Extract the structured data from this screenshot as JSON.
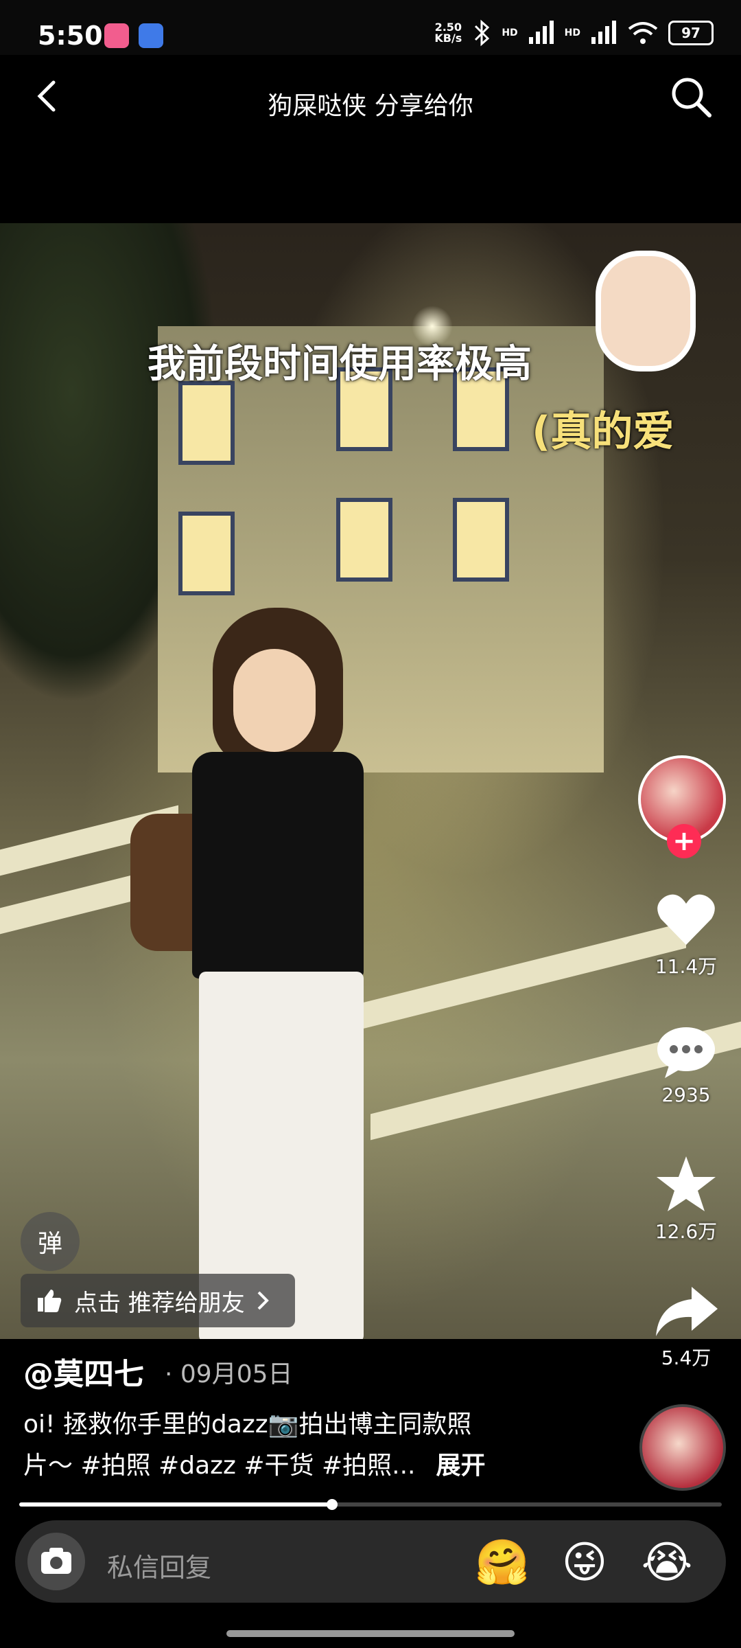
{
  "status_bar": {
    "time": "5:50",
    "net_speed_value": "2.50",
    "net_speed_unit": "KB/s",
    "hd1": "HD",
    "hd2": "HD",
    "battery": "97"
  },
  "nav": {
    "title": "狗屎哒侠 分享给你"
  },
  "video": {
    "caption_main": "我前段时间使用率极高",
    "caption_sub": "(真的爱",
    "danmu_label": "弹",
    "recommend_label": "点击 推荐给朋友"
  },
  "actions": {
    "likes": "11.4万",
    "comments": "2935",
    "favorites": "12.6万",
    "shares": "5.4万"
  },
  "post": {
    "author": "@莫四七",
    "date": "· 09月05日",
    "desc_line1": "oi! 拯救你手里的dazz📷拍出博主同款照",
    "desc_line2": "片～ #拍照 #dazz #干货 #拍照...",
    "expand": "展开"
  },
  "playback": {
    "progress": 0.445
  },
  "reply": {
    "placeholder": "私信回复",
    "emoji1": "🤗",
    "emoji2": "😜",
    "emoji3": "😭"
  },
  "colors": {
    "accent": "#fe2c55",
    "caption_sub": "#f7e07a"
  }
}
